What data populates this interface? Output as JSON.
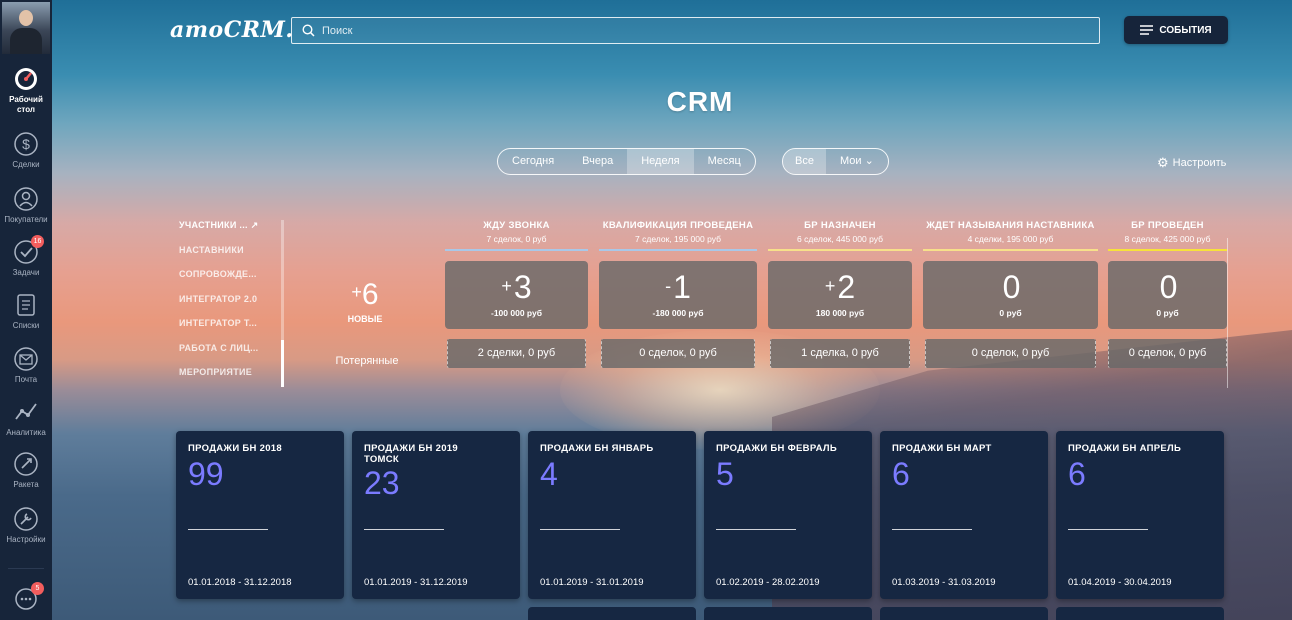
{
  "app": {
    "logo": "amoCRM."
  },
  "sidebar": {
    "items": [
      {
        "label": "Рабочий стол",
        "icon": "dashboard-icon",
        "active": true
      },
      {
        "label": "Сделки",
        "icon": "deals-icon"
      },
      {
        "label": "Покупатели",
        "icon": "customers-icon"
      },
      {
        "label": "Задачи",
        "icon": "tasks-icon",
        "badge": "16"
      },
      {
        "label": "Списки",
        "icon": "lists-icon"
      },
      {
        "label": "Почта",
        "icon": "mail-icon"
      },
      {
        "label": "Аналитика",
        "icon": "analytics-icon"
      },
      {
        "label": "Ракета",
        "icon": "rocket-icon"
      },
      {
        "label": "Настройки",
        "icon": "settings-icon"
      }
    ],
    "chat_badge": "5"
  },
  "header": {
    "search_placeholder": "Поиск",
    "events_label": "СОБЫТИЯ"
  },
  "page_title": "CRM",
  "filters": {
    "periods": [
      "Сегодня",
      "Вчера",
      "Неделя",
      "Месяц"
    ],
    "active_period": "Неделя",
    "owners": [
      "Все",
      "Мои"
    ],
    "active_owner": "Мои",
    "settings_label": "Настроить"
  },
  "pipelines": {
    "items": [
      "УЧАСТНИКИ ...",
      "НАСТАВНИКИ",
      "СОПРОВОЖДЕ...",
      "ИНТЕГРАТОР 2.0",
      "ИНТЕГРАТОР Т...",
      "РАБОТА С ЛИЦ...",
      "МЕРОПРИЯТИЕ"
    ]
  },
  "summary": {
    "new_sign": "+",
    "new_count": "6",
    "new_label": "НОВЫЕ",
    "lost_label": "Потерянные"
  },
  "stages": [
    {
      "name": "ЖДУ ЗВОНКА",
      "meta": "7 сделок, 0 руб",
      "color": "#a9c8e8",
      "sign": "+",
      "value": "3",
      "money": "-100 000 руб",
      "lost": "2 сделки, 0 руб"
    },
    {
      "name": "КВАЛИФИКАЦИЯ ПРОВЕДЕНА",
      "meta": "7 сделок, 195 000 руб",
      "color": "#a9c8e8",
      "sign": "-",
      "value": "1",
      "money": "-180 000 руб",
      "lost": "0 сделок, 0 руб"
    },
    {
      "name": "БР НАЗНАЧЕН",
      "meta": "6 сделок, 445 000 руб",
      "color": "#f7e08a",
      "sign": "+",
      "value": "2",
      "money": "180 000 руб",
      "lost": "1 сделка, 0 руб"
    },
    {
      "name": "ЖДЕТ НАЗЫВАНИЯ НАСТАВНИКА",
      "meta": "4 сделки, 195 000 руб",
      "color": "#f7e08a",
      "sign": "",
      "value": "0",
      "money": "0 руб",
      "lost": "0 сделок, 0 руб"
    },
    {
      "name": "БР ПРОВЕДЕН",
      "meta": "8 сделок, 425 000 руб",
      "color": "#f7e23a",
      "sign": "",
      "value": "0",
      "money": "0 руб",
      "lost": "0 сделок, 0 руб"
    }
  ],
  "widgets": [
    {
      "title": "ПРОДАЖИ БН 2018",
      "value": "99",
      "dates": "01.01.2018 - 31.12.2018"
    },
    {
      "title": "ПРОДАЖИ БН 2019 ТОМСК",
      "value": "23",
      "dates": "01.01.2019 - 31.12.2019"
    },
    {
      "title": "ПРОДАЖИ БН ЯНВАРЬ",
      "value": "4",
      "dates": "01.01.2019 - 31.01.2019"
    },
    {
      "title": "ПРОДАЖИ БН ФЕВРАЛЬ",
      "value": "5",
      "dates": "01.02.2019 - 28.02.2019"
    },
    {
      "title": "ПРОДАЖИ БН МАРТ",
      "value": "6",
      "dates": "01.03.2019 - 31.03.2019"
    },
    {
      "title": "ПРОДАЖИ БН АПРЕЛЬ",
      "value": "6",
      "dates": "01.04.2019 - 30.04.2019"
    }
  ]
}
